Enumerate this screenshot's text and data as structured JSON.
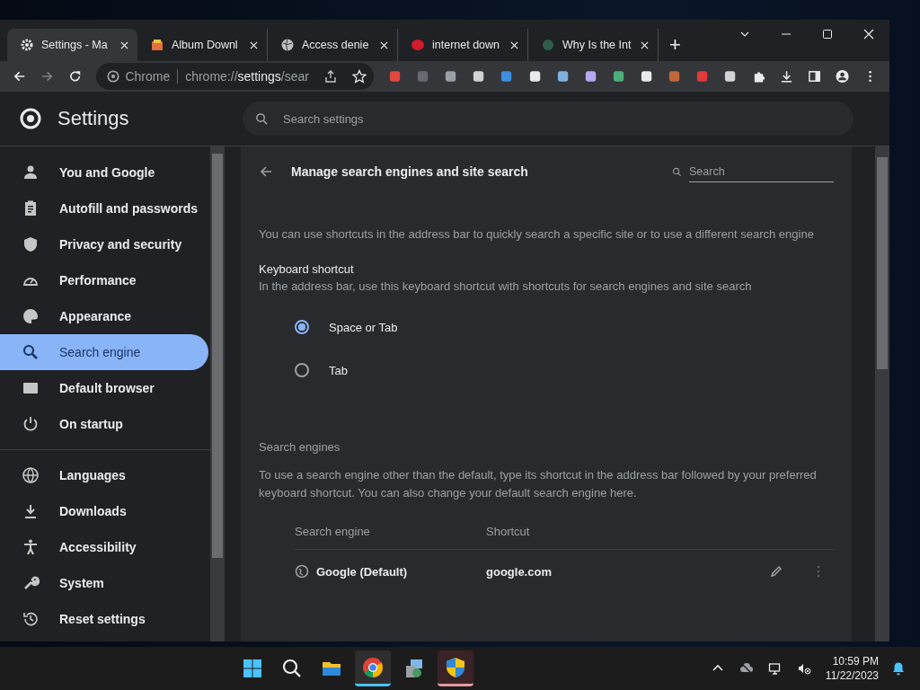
{
  "browser": {
    "tabs": [
      {
        "title": "Settings - Ma",
        "selected": true
      },
      {
        "title": "Album Downl",
        "selected": false
      },
      {
        "title": "Access denie",
        "selected": false
      },
      {
        "title": "internet down",
        "selected": false
      },
      {
        "title": "Why Is the Int",
        "selected": false
      }
    ],
    "new_tab": "+",
    "omnibox": {
      "chip": "Chrome",
      "url_prefix": "chrome://",
      "url_host": "settings",
      "url_path": "/sear"
    }
  },
  "settings": {
    "title": "Settings",
    "search": {
      "placeholder": "Search settings"
    },
    "sidebar": {
      "sections": [
        {
          "items": [
            {
              "label": "You and Google",
              "selected": false
            },
            {
              "label": "Autofill and passwords",
              "selected": false
            },
            {
              "label": "Privacy and security",
              "selected": false
            },
            {
              "label": "Performance",
              "selected": false
            },
            {
              "label": "Appearance",
              "selected": false
            },
            {
              "label": "Search engine",
              "selected": true
            },
            {
              "label": "Default browser",
              "selected": false
            },
            {
              "label": "On startup",
              "selected": false
            }
          ]
        },
        {
          "items": [
            {
              "label": "Languages",
              "selected": false
            },
            {
              "label": "Downloads",
              "selected": false
            },
            {
              "label": "Accessibility",
              "selected": false
            },
            {
              "label": "System",
              "selected": false
            },
            {
              "label": "Reset settings",
              "selected": false
            }
          ]
        }
      ]
    },
    "page": {
      "title": "Manage search engines and site search",
      "search": {
        "placeholder": "Search"
      },
      "intro": "You can use shortcuts in the address bar to quickly search a specific site or to use a different search engine",
      "keyboard_shortcut": {
        "heading": "Keyboard shortcut",
        "description": "In the address bar, use this keyboard shortcut with shortcuts for search engines and site search",
        "options": [
          {
            "label": "Space or Tab",
            "selected": true
          },
          {
            "label": "Tab",
            "selected": false
          }
        ]
      },
      "search_engines": {
        "heading": "Search engines",
        "description": "To use a search engine other than the default, type its shortcut in the address bar followed by your preferred keyboard shortcut. You can also change your default search engine here.",
        "columns": [
          "Search engine",
          "Shortcut"
        ],
        "rows": [
          {
            "name": "Google (Default)",
            "shortcut": "google.com"
          }
        ]
      }
    }
  },
  "taskbar": {
    "time": "10:59 PM",
    "date": "11/22/2023"
  }
}
